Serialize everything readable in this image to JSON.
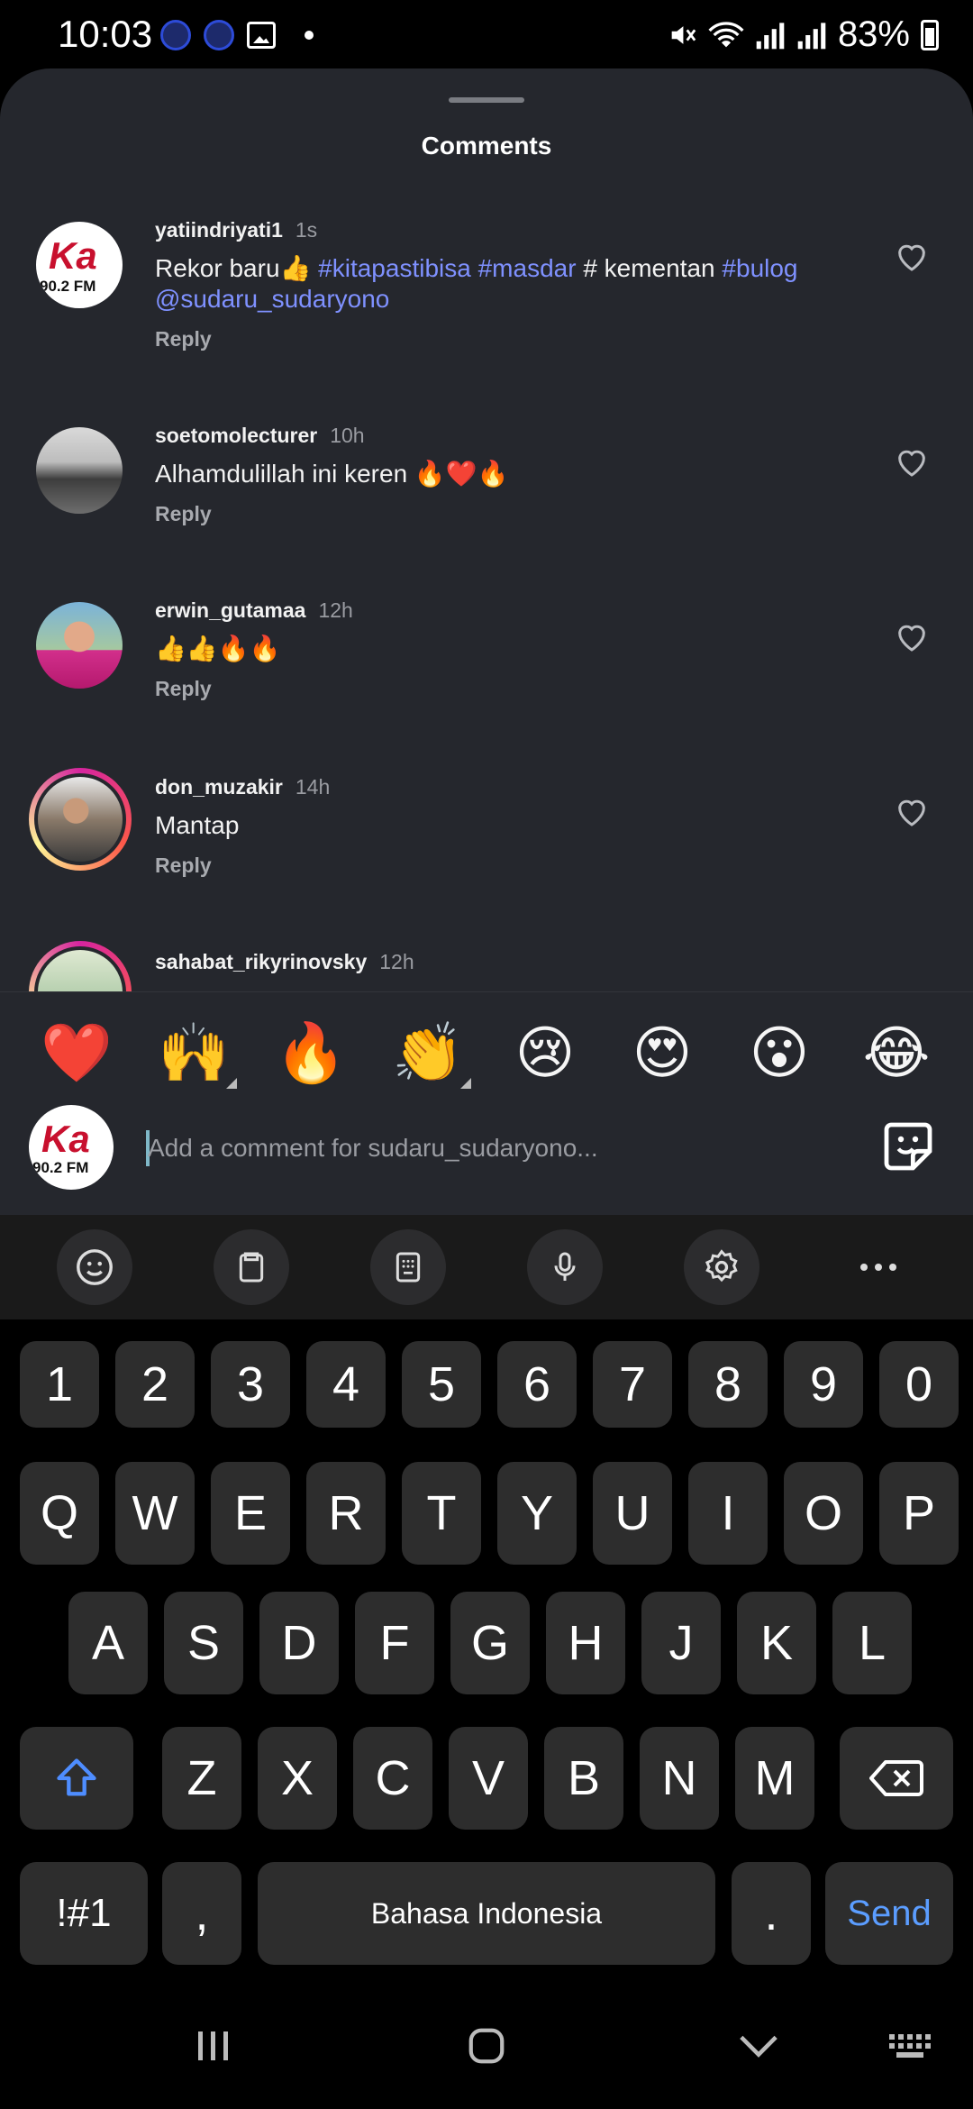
{
  "status_bar": {
    "time": "10:03",
    "battery": "83%"
  },
  "sheet": {
    "title": "Comments"
  },
  "comments": [
    {
      "user": "yatiindriyati1",
      "time": "1s",
      "text_plain": "Rekor baru👍 ",
      "tags_line1": [
        "#kitapastibisa",
        "#masdar"
      ],
      "text_mid": "# kementan",
      "tags_line1b": "#bulog",
      "mention": "@sudaru_sudaryono",
      "reply": "Reply"
    },
    {
      "user": "soetomolecturer",
      "time": "10h",
      "text": "Alhamdulillah ini keren 🔥❤️🔥",
      "reply": "Reply"
    },
    {
      "user": "erwin_gutamaa",
      "time": "12h",
      "text": "👍👍🔥🔥",
      "reply": "Reply"
    },
    {
      "user": "don_muzakir",
      "time": "14h",
      "text": "Mantap",
      "reply": "Reply"
    },
    {
      "user": "sahabat_rikyrinovsky",
      "time": "12h"
    }
  ],
  "emoji_bar": [
    "❤️",
    "🙌",
    "🔥",
    "👏",
    "😢",
    "😍",
    "😮",
    "😂"
  ],
  "composer": {
    "placeholder": "Add a comment for sudaru_sudaryono..."
  },
  "avatar_text": {
    "logo": "Ka",
    "freq": "90.2 FM"
  },
  "keyboard": {
    "row_numbers": [
      "1",
      "2",
      "3",
      "4",
      "5",
      "6",
      "7",
      "8",
      "9",
      "0"
    ],
    "row_q": [
      "Q",
      "W",
      "E",
      "R",
      "T",
      "Y",
      "U",
      "I",
      "O",
      "P"
    ],
    "row_a": [
      "A",
      "S",
      "D",
      "F",
      "G",
      "H",
      "J",
      "K",
      "L"
    ],
    "row_z": [
      "Z",
      "X",
      "C",
      "V",
      "B",
      "N",
      "M"
    ],
    "symbols": "!#1",
    "comma": ",",
    "space": "Bahasa Indonesia",
    "period": ".",
    "send": "Send"
  },
  "colors": {
    "sheet_bg": "#25272d",
    "hashtag": "#7f91ff",
    "send": "#5b9dff",
    "key_bg": "#2d2d2d"
  }
}
